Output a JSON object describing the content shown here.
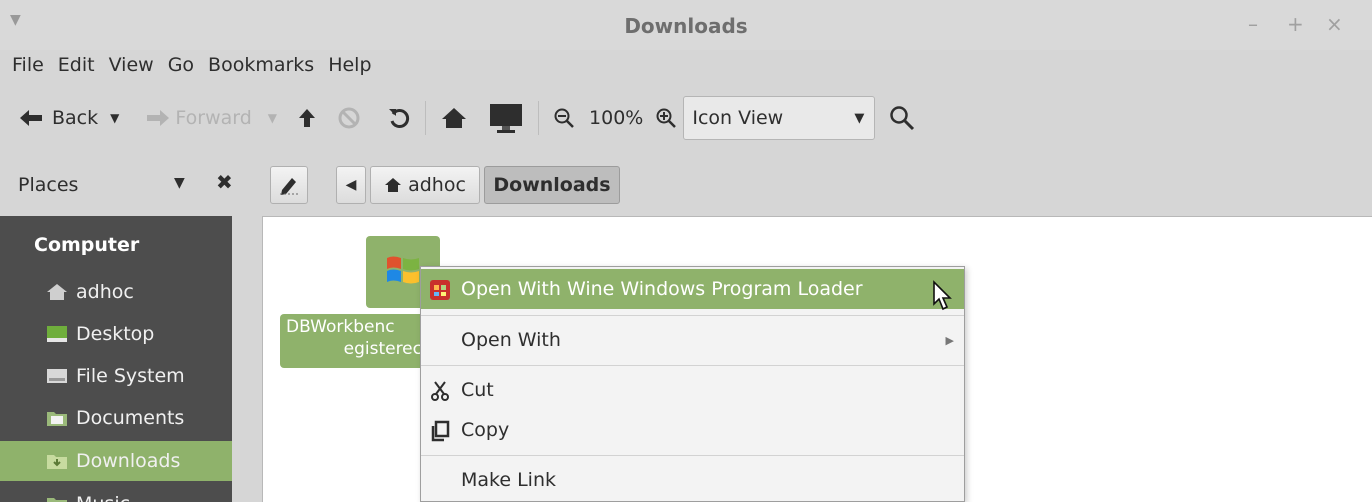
{
  "window": {
    "title": "Downloads",
    "controls": {
      "minimize": "–",
      "maximize": "+",
      "close": "×"
    }
  },
  "menubar": [
    "File",
    "Edit",
    "View",
    "Go",
    "Bookmarks",
    "Help"
  ],
  "toolbar": {
    "back_label": "Back",
    "forward_label": "Forward",
    "zoom_level": "100%",
    "view_mode": "Icon View"
  },
  "locationbar": {
    "places_label": "Places",
    "crumbs": [
      "adhoc",
      "Downloads"
    ]
  },
  "sidebar": {
    "heading": "Computer",
    "items": [
      {
        "label": "adhoc",
        "icon": "home-icon"
      },
      {
        "label": "Desktop",
        "icon": "desktop-icon"
      },
      {
        "label": "File System",
        "icon": "drive-icon"
      },
      {
        "label": "Documents",
        "icon": "folder-icon"
      },
      {
        "label": "Downloads",
        "icon": "folder-download-icon",
        "selected": true
      },
      {
        "label": "Music",
        "icon": "folder-music-icon"
      }
    ]
  },
  "files": [
    {
      "name_line1": "DBWorkbenc",
      "name_line2": "egisterec"
    }
  ],
  "context_menu": {
    "items": [
      {
        "label": "Open With Wine Windows Program Loader",
        "highlighted": true
      },
      {
        "label": "Open With",
        "submenu": true
      },
      {
        "label": "Cut"
      },
      {
        "label": "Copy"
      },
      {
        "label": "Make Link"
      }
    ]
  },
  "colors": {
    "accent": "#8fb26b",
    "sidebar": "#4d4d4d"
  }
}
